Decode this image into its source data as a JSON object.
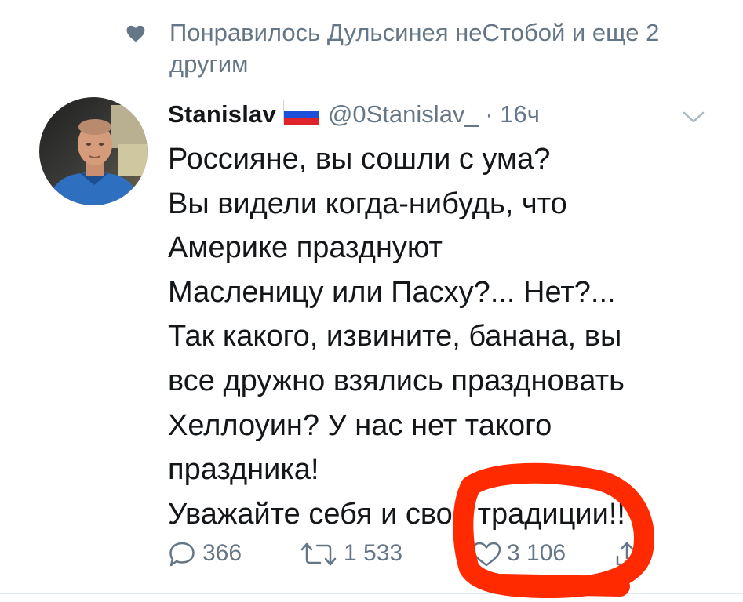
{
  "social_context": {
    "icon": "heart-icon",
    "text": "Понравилось Дульсинея неСтобой и еще 2 другим"
  },
  "tweet": {
    "author_name": "Stanislav",
    "flag": "russian-flag-icon",
    "handle": "@0Stanislav_",
    "time_separator": " · ",
    "time": "16ч",
    "text": "Россияне, вы сошли с ума?\nВы видели когда-нибудь, что\nАмерике празднуют\nМасленицу или Пасху?... Нет?...\nТак какого, извините, банана, вы\nвсе дружно взялись праздновать\nХеллоуин? У нас нет такого\nпраздника!\nУважайте себя и свои традиции!!"
  },
  "actions": {
    "reply_count": "366",
    "retweet_count": "1 533",
    "like_count": "3 106"
  },
  "colors": {
    "text": "#14171a",
    "muted": "#657786",
    "annotation": "#ff2a00"
  }
}
